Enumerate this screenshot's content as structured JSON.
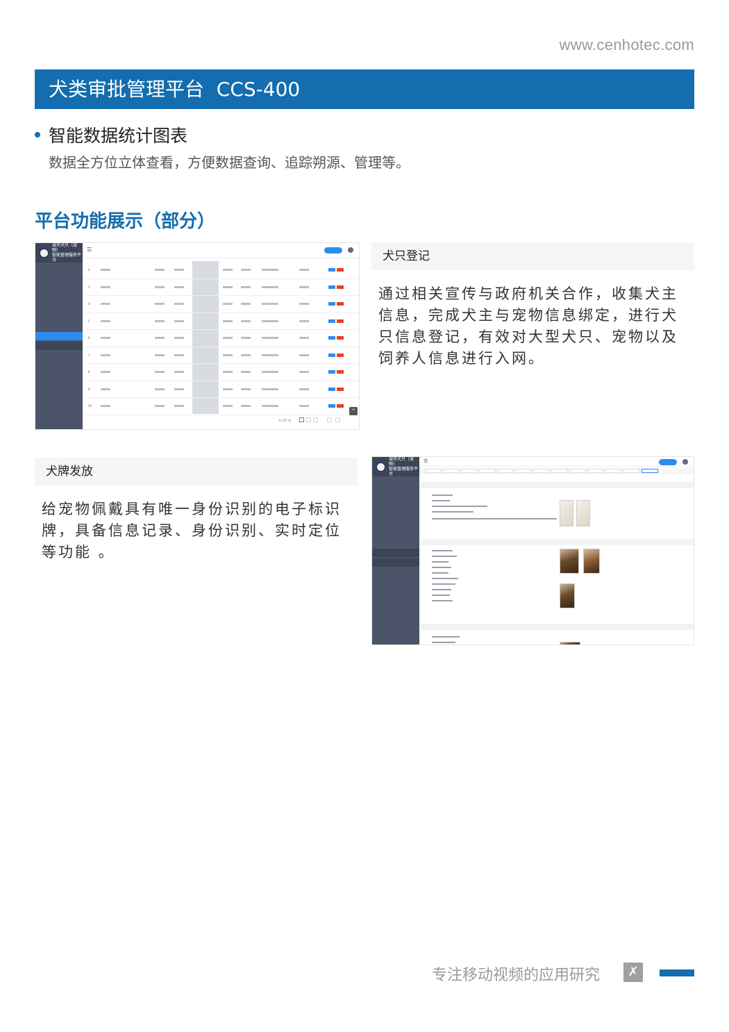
{
  "header": {
    "site_url": "www.cenhotec.com"
  },
  "title_bar": {
    "title": "犬类审批管理平台  CCS-400"
  },
  "feature": {
    "heading": "智能数据统计图表",
    "description": "数据全方位立体查看，方便数据查询、追踪朔源、管理等。"
  },
  "section": {
    "title": "平台功能展示（部分）"
  },
  "panels": {
    "registration": {
      "caption": "犬只登记",
      "text": "通过相关宣传与政府机关合作，收集犬主信息，完成犬主与宠物信息绑定，进行犬只信息登记，有效对大型犬只、宠物以及饲养人信息进行入网。"
    },
    "tag_issue": {
      "caption": "犬牌发放",
      "text": "给宠物佩戴具有唯一身份识别的电子标识牌，具备信息记录、身份识别、实时定位等功能 。"
    }
  },
  "screenshot_list": {
    "logo_line1": "城市犬只（宠物）",
    "logo_line2": "智能管理服务平台",
    "row_numbers": [
      "2",
      "3",
      "4",
      "5",
      "6",
      "7",
      "8",
      "9",
      "10"
    ],
    "pager_total": "共 287 条"
  },
  "screenshot_detail": {
    "logo_line1": "城市犬只（宠物）",
    "logo_line2": "智能管理服务平台"
  },
  "footer": {
    "slogan": "专注移动视频的应用研究",
    "logo_icon": "x-logo-icon",
    "accent": "#136dae"
  },
  "colors": {
    "brand_blue": "#136dae",
    "sidebar": "#4b5468",
    "accent_blue": "#2d8cf0",
    "danger": "#ed4014"
  }
}
